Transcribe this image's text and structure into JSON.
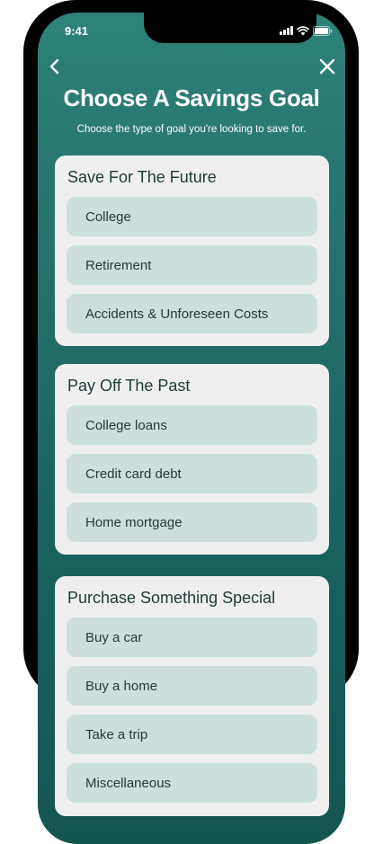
{
  "status_bar": {
    "time": "9:41",
    "icons": [
      "signal-icon",
      "wifi-icon",
      "battery-icon"
    ]
  },
  "nav": {
    "back_icon": "chevron-left-icon",
    "close_icon": "close-icon"
  },
  "header": {
    "title": "Choose A Savings Goal",
    "subtitle": "Choose the type of goal you're looking to save for."
  },
  "colors": {
    "screen_top": "#2e8278",
    "screen_bottom": "#13564f",
    "card_bg": "#efefef",
    "option_bg": "#ccdfdd",
    "heading_text": "#1e3a36"
  },
  "groups": [
    {
      "heading": "Save For The Future",
      "options": [
        "College",
        "Retirement",
        "Accidents & Unforeseen Costs"
      ]
    },
    {
      "heading": "Pay Off The Past",
      "options": [
        "College loans",
        "Credit card debt",
        "Home mortgage"
      ]
    },
    {
      "heading": "Purchase Something Special",
      "options": [
        "Buy a car",
        "Buy a home",
        "Take a trip",
        "Miscellaneous"
      ]
    }
  ]
}
